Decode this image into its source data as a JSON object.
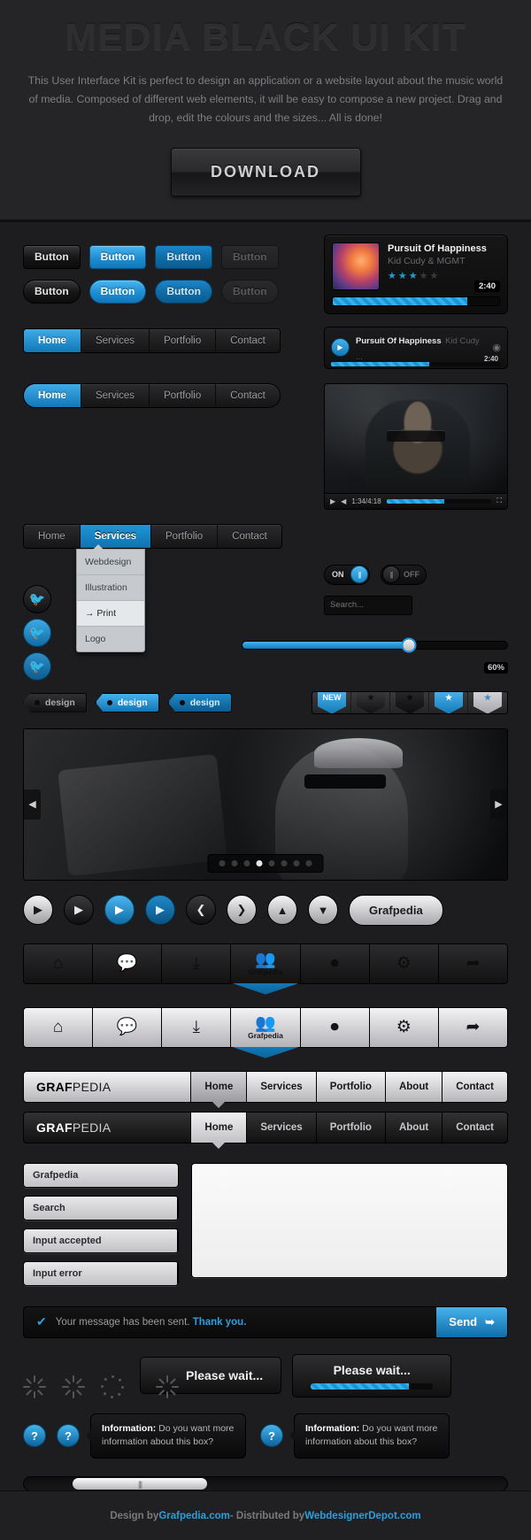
{
  "header": {
    "title": "MEDIA BLACK UI KIT",
    "description": "This User Interface Kit is perfect to design an application or a website layout about the music world of media. Composed of different web elements, it will be easy to compose a new project. Drag and drop, edit the colours and the sizes... All is done!",
    "download_label": "DOWNLOAD"
  },
  "buttons": {
    "square": [
      {
        "label": "Button",
        "style": "dark"
      },
      {
        "label": "Button",
        "style": "blue"
      },
      {
        "label": "Button",
        "style": "blue2"
      },
      {
        "label": "Button",
        "style": "off"
      }
    ],
    "rounded": [
      {
        "label": "Button",
        "style": "dark"
      },
      {
        "label": "Button",
        "style": "blue"
      },
      {
        "label": "Button",
        "style": "blue2"
      },
      {
        "label": "Button",
        "style": "off"
      }
    ]
  },
  "player": {
    "title": "Pursuit Of Happiness",
    "artist": "Kid Cudy & MGMT",
    "duration": "2:40",
    "rating": 3,
    "rating_max": 5,
    "progress_pct": 81
  },
  "player_small": {
    "title": "Pursuit Of Happiness",
    "artist": "Kid Cudy ...",
    "duration": "2:40",
    "progress_pct": 58,
    "play_icon": "play-icon",
    "eye_icon": "eye-icon"
  },
  "nav": {
    "items": [
      "Home",
      "Services",
      "Portfolio",
      "Contact"
    ],
    "active_square": "Home",
    "active_pill": "Home",
    "active_dropdown": "Services"
  },
  "dropdown": {
    "items": [
      "Webdesign",
      "Illustration",
      "→ Print",
      "Logo"
    ],
    "highlighted": "→ Print"
  },
  "social": {
    "icons": [
      "twitter-icon",
      "twitter-icon",
      "twitter-icon"
    ],
    "glyph": "🐦"
  },
  "toggles": {
    "on_label": "ON",
    "off_label": "OFF",
    "grip": "|||"
  },
  "search": {
    "placeholder": "Search...",
    "icon": "search-icon"
  },
  "video": {
    "current_time": "1:34",
    "total_time": "4:18",
    "progress_pct": 55
  },
  "slider": {
    "value_pct": 65,
    "label": "60%"
  },
  "tags": [
    {
      "label": "design",
      "style": "dark"
    },
    {
      "label": "design",
      "style": "blue"
    },
    {
      "label": "design",
      "style": "blue2"
    }
  ],
  "ribbons": [
    {
      "label": "NEW",
      "style": "blue"
    },
    {
      "label": "★",
      "style": "dark"
    },
    {
      "label": "★",
      "style": "dark2"
    },
    {
      "label": "★",
      "style": "blue-star"
    },
    {
      "label": "★",
      "style": "gray-star"
    }
  ],
  "slideshow": {
    "prev_icon": "chevron-left-icon",
    "next_icon": "chevron-right-icon",
    "dots": 8,
    "active_dot": 3
  },
  "circle_buttons": [
    {
      "icon": "play-icon",
      "glyph": "▶",
      "style": "light"
    },
    {
      "icon": "play-icon",
      "glyph": "▶",
      "style": "dark"
    },
    {
      "icon": "play-icon",
      "glyph": "▶",
      "style": "blue"
    },
    {
      "icon": "play-icon",
      "glyph": "▶",
      "style": "blue2"
    },
    {
      "icon": "chevron-left-icon",
      "glyph": "❮",
      "style": "dark"
    },
    {
      "icon": "chevron-right-icon",
      "glyph": "❯",
      "style": "light"
    },
    {
      "icon": "chevron-up-icon",
      "glyph": "❭",
      "style": "light"
    },
    {
      "icon": "chevron-down-icon",
      "glyph": "❭",
      "style": "light"
    }
  ],
  "pill_button": {
    "label": "Grafpedia"
  },
  "toolbar": {
    "active_label": "Grafpedia",
    "items": [
      {
        "icon": "home-icon",
        "glyph": "⌂"
      },
      {
        "icon": "chat-icon",
        "glyph": "💬"
      },
      {
        "icon": "download-icon",
        "glyph": "⤓"
      },
      {
        "icon": "users-icon",
        "glyph": "👥",
        "label": "Grafpedia",
        "active": true
      },
      {
        "icon": "camera-icon",
        "glyph": "⏺"
      },
      {
        "icon": "gear-icon",
        "glyph": "⚙"
      },
      {
        "icon": "share-icon",
        "glyph": "➦"
      }
    ]
  },
  "menubar": {
    "brand_bold": "GRAF",
    "brand_light": "PEDIA",
    "items": [
      "Home",
      "Services",
      "Portfolio",
      "About",
      "Contact"
    ],
    "active": "Home"
  },
  "forms": {
    "text_value": "Grafpedia",
    "search_value": "Search",
    "search_icon": "search-icon",
    "accepted_value": "Input accepted",
    "accepted_icon": "check-icon",
    "error_value": "Input error",
    "error_icon": "close-icon"
  },
  "message": {
    "text": "Your message has been sent.",
    "bold": "Thank you.",
    "check_icon": "check-icon",
    "send_label": "Send",
    "send_icon": "arrow-right-icon"
  },
  "loaders": {
    "wait_label": "Please wait...",
    "wait_label_2": "Please wait...",
    "progress_pct": 80
  },
  "tooltips": {
    "help_glyph": "?",
    "title": "Information:",
    "body": "Do you want more information about this box?"
  },
  "scrollbar": {
    "grip": "|||"
  },
  "footer": {
    "prefix": "Design by ",
    "link1": "Grafpedia.com",
    "middle": " - Distributed by ",
    "link2": "WebdesignerDepot.com"
  }
}
